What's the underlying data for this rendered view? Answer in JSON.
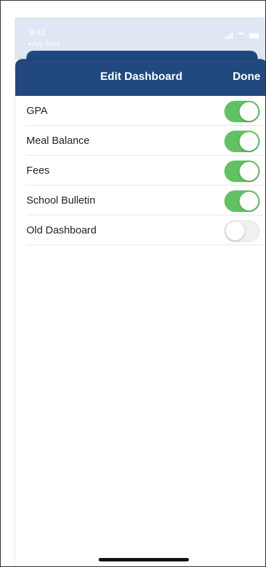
{
  "status_bar": {
    "time": "9:41",
    "back_app": "◂ App Store"
  },
  "navbar": {
    "title": "Edit Dashboard",
    "done_label": "Done",
    "color": "#21497f"
  },
  "settings": [
    {
      "label": "GPA",
      "enabled": true
    },
    {
      "label": "Meal Balance",
      "enabled": true
    },
    {
      "label": "Fees",
      "enabled": true
    },
    {
      "label": "School Bulletin",
      "enabled": true
    },
    {
      "label": "Old Dashboard",
      "enabled": false
    }
  ],
  "colors": {
    "toggle_on": "#62c162",
    "toggle_off": "#f0f0f0"
  }
}
